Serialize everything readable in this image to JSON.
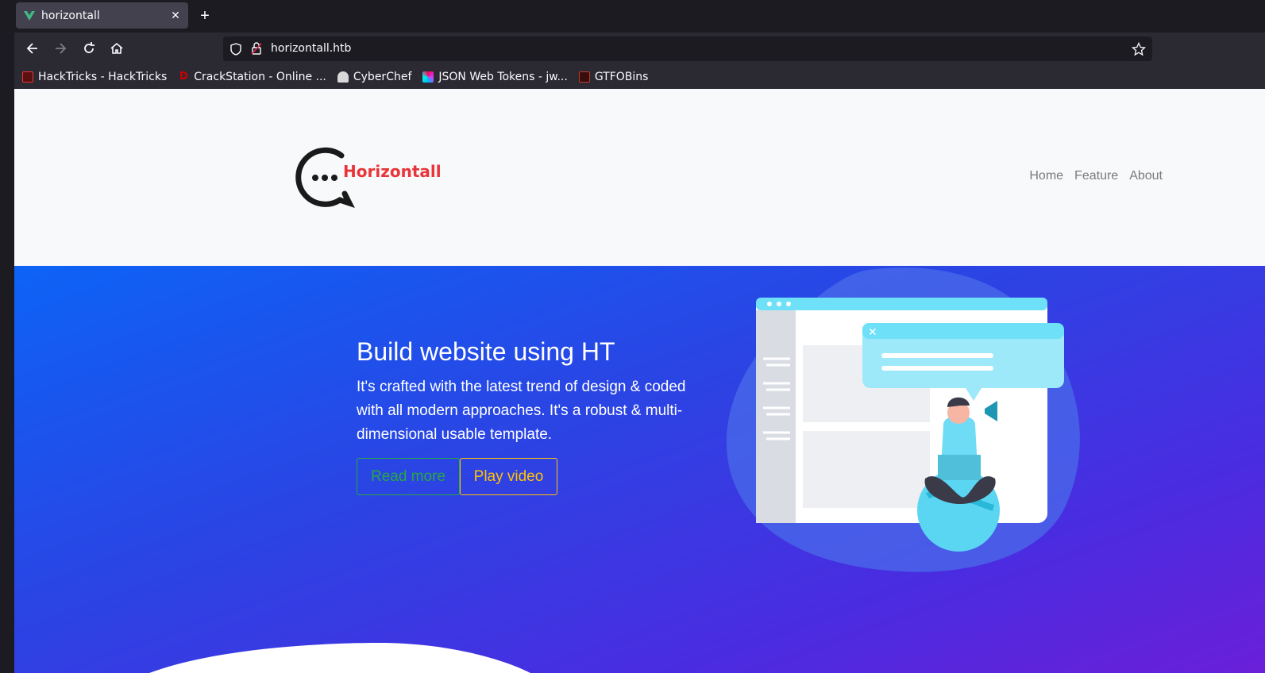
{
  "browser": {
    "tab_title": "horizontall",
    "url": "horizontall.htb",
    "bookmarks": [
      {
        "label": "HackTricks - HackTricks",
        "color": "#e8353a"
      },
      {
        "label": "CrackStation - Online ...",
        "color": "#cc0000"
      },
      {
        "label": "CyberChef",
        "color": "#d9d9d9"
      },
      {
        "label": "JSON Web Tokens - jw...",
        "color": "#7b3fe4"
      },
      {
        "label": "GTFOBins",
        "color": "#c0392b"
      }
    ]
  },
  "site": {
    "logo_text": "Horizontall",
    "nav": [
      "Home",
      "Feature",
      "About"
    ],
    "hero": {
      "title": "Build website using HT",
      "subtitle": "It's crafted with the latest trend of design & coded with all modern approaches. It's a robust & multi-dimensional usable template.",
      "read_more": "Read more",
      "play_video": "Play video"
    }
  },
  "colors": {
    "accent_green": "#28a745",
    "accent_yellow": "#ffc107",
    "logo_red": "#e8353a"
  }
}
